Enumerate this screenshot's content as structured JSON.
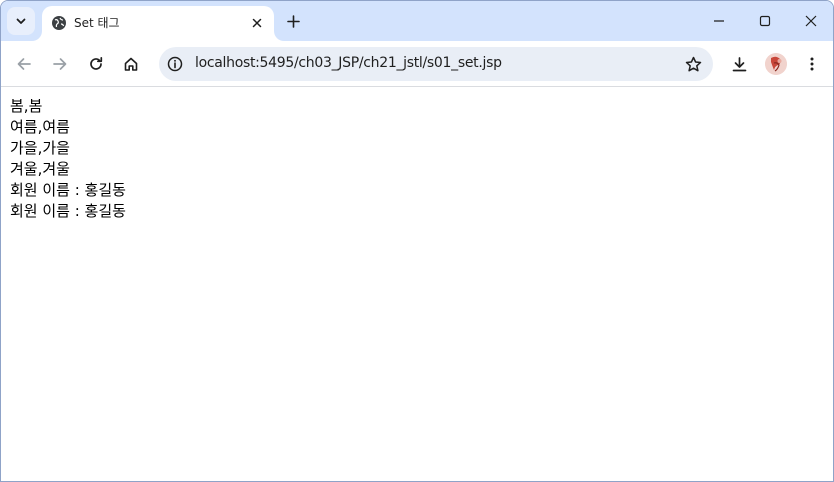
{
  "browser": {
    "tab": {
      "title": "Set 태그"
    },
    "address_bar": {
      "url": "localhost:5495/ch03_JSP/ch21_jstl/s01_set.jsp"
    }
  },
  "page": {
    "lines": [
      "봄,봄",
      "여름,여름",
      "가을,가을",
      "겨울,겨울",
      "회원 이름 : 홍길동",
      "회원 이름 : 홍길동"
    ]
  },
  "colors": {
    "tabstrip_bg": "#d3e3fd",
    "omnibox_bg": "#e9eef6",
    "icon": "#1f1f1f"
  }
}
